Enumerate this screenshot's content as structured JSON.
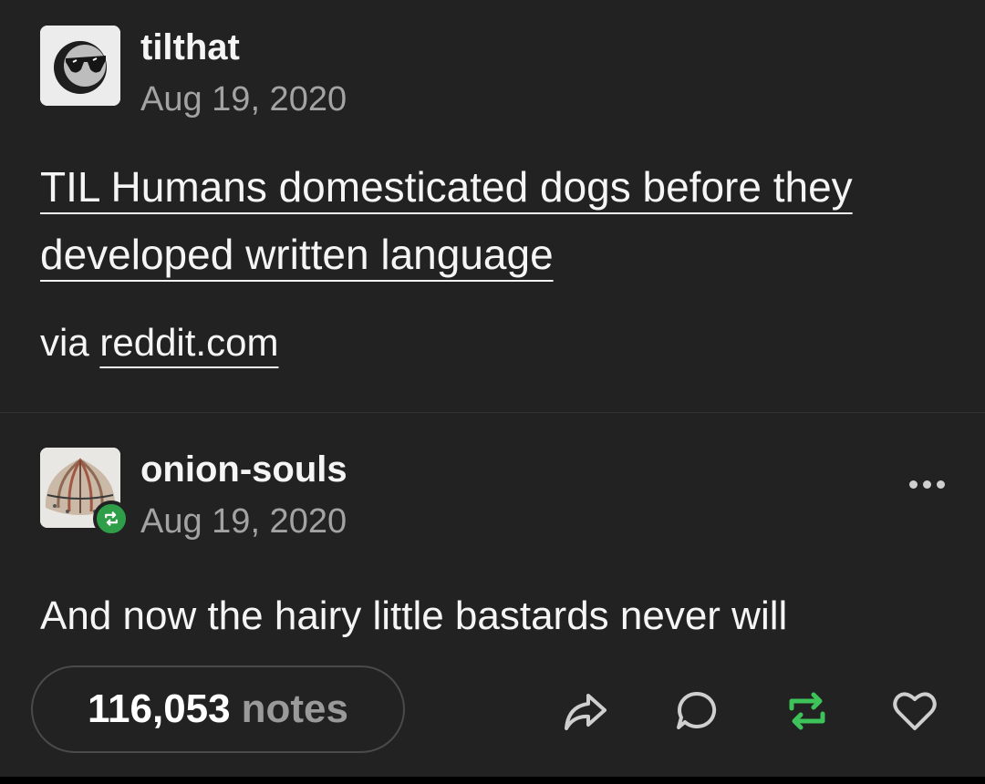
{
  "post1": {
    "username": "tilthat",
    "date": "Aug 19, 2020",
    "title": "TIL Humans domesticated dogs before they developed written language",
    "via_prefix": "via",
    "via_link": "reddit.com"
  },
  "post2": {
    "username": "onion-souls",
    "date": "Aug 19, 2020",
    "reply_text": "And now the hairy little bastards never will"
  },
  "footer": {
    "notes_count": "116,053",
    "notes_label": "notes"
  },
  "colors": {
    "background": "#222222",
    "reblog_green": "#3ec25a",
    "secondary_text": "#a3a3a3"
  },
  "icons": [
    "sunglasses-avatar-icon",
    "onion-avatar-icon",
    "reblog-badge-icon",
    "more-options-icon",
    "share-icon",
    "reply-icon",
    "reblog-icon",
    "like-icon"
  ]
}
